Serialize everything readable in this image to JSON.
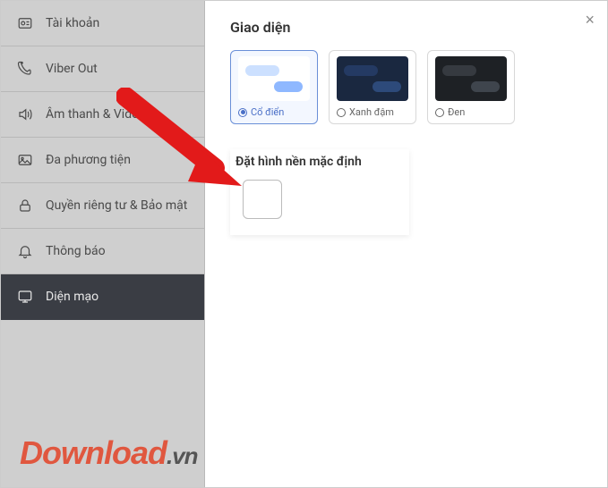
{
  "sidebar": {
    "items": [
      {
        "label": "Tài khoản"
      },
      {
        "label": "Viber Out"
      },
      {
        "label": "Âm thanh & Video"
      },
      {
        "label": "Đa phương tiện"
      },
      {
        "label": "Quyền riêng tư & Bảo mật"
      },
      {
        "label": "Thông báo"
      },
      {
        "label": "Diện mạo"
      }
    ]
  },
  "content": {
    "interface_title": "Giao diện",
    "themes": [
      {
        "label": "Cổ điển",
        "selected": true
      },
      {
        "label": "Xanh đậm",
        "selected": false
      },
      {
        "label": "Đen",
        "selected": false
      }
    ],
    "bg_title": "Đặt hình nền mặc định"
  },
  "watermark": {
    "main": "Download",
    "tld": ".vn"
  }
}
